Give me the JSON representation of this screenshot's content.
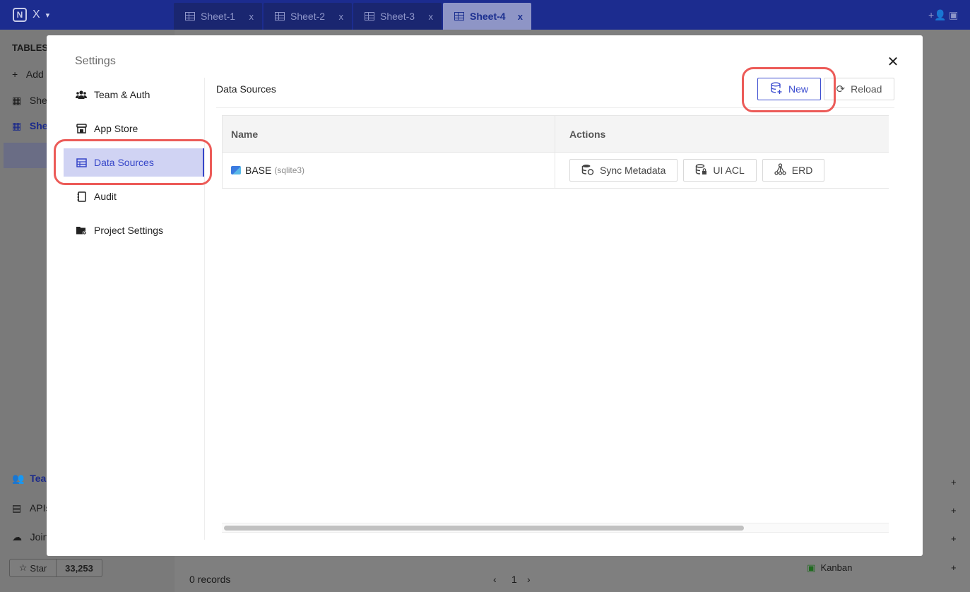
{
  "app": {
    "brand_letter": "N",
    "brand_name": "X"
  },
  "tabs": [
    {
      "label": "Sheet-1",
      "close": "x"
    },
    {
      "label": "Sheet-2",
      "close": "x"
    },
    {
      "label": "Sheet-3",
      "close": "x"
    },
    {
      "label": "Sheet-4",
      "close": "x"
    }
  ],
  "sidebar": {
    "heading": "TABLES",
    "add_label": "Add",
    "items": [
      "She",
      "She"
    ],
    "bottom_items": [
      "Tea",
      "APIs",
      "Join"
    ],
    "star_label": "Star",
    "star_count": "33,253"
  },
  "footer": {
    "records": "0 records",
    "page": "1"
  },
  "right_panel": {
    "kanban_label": "Kanban"
  },
  "modal": {
    "title": "Settings",
    "nav": [
      {
        "label": "Team & Auth",
        "icon": "team-icon"
      },
      {
        "label": "App Store",
        "icon": "store-icon"
      },
      {
        "label": "Data Sources",
        "icon": "data-sources-icon"
      },
      {
        "label": "Audit",
        "icon": "audit-icon"
      },
      {
        "label": "Project Settings",
        "icon": "project-settings-icon"
      }
    ],
    "panel_title": "Data Sources",
    "new_button": "New",
    "reload_button": "Reload",
    "table": {
      "columns": [
        "Name",
        "Actions"
      ],
      "rows": [
        {
          "name": "BASE",
          "type": "(sqlite3)",
          "actions": [
            "Sync Metadata",
            "UI ACL",
            "ERD"
          ]
        }
      ]
    }
  },
  "colors": {
    "accent": "#3c4dd0",
    "highlight": "#ec5b58",
    "topbar": "#1c2c8f"
  }
}
